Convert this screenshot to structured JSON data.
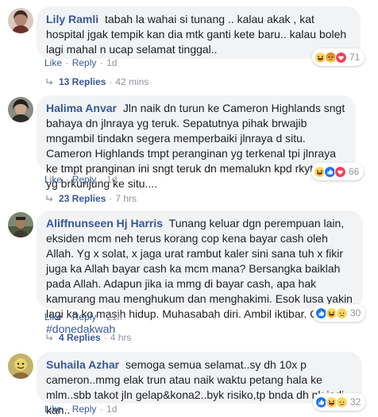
{
  "comments": [
    {
      "author": "Lily Ramli",
      "text": "tabah la wahai si tunang .. kalau akak , kat hospital jgak tempik kan dia mtk ganti kete baru.. kalau boleh lagi mahal n ucap selamat tinggal..",
      "like": "Like",
      "reply": "Reply",
      "time": "1d",
      "reaction_count": "71",
      "reaction_icons": [
        "haha-icon",
        "angry-icon",
        "love-icon"
      ],
      "replies": "13 Replies",
      "replies_time": "42 mins"
    },
    {
      "author": "Halima Anvar",
      "text": "Jln naik dn turun ke Cameron Highlands sngt bahaya dn jlnraya yg teruk. Sepatutnya pihak brwajib mngambil tindakn segera memperbaiki jlnraya d situ. Cameron Highlands tmpt peranginan yg terkenal tpi jlnraya ke tmpt pranginan ini sngt teruk dn memalukn kpd rkyt luar yg brkunjung ke situ....",
      "like": "Like",
      "reply": "Reply",
      "time": "1d",
      "reaction_count": "66",
      "reaction_icons": [
        "haha-icon",
        "like-icon",
        "love-icon"
      ],
      "replies": "23 Replies",
      "replies_time": "7 hrs"
    },
    {
      "author": "Aliffnunseen Hj Harris",
      "text": "Tunang keluar dgn perempuan lain, eksiden mcm neh terus korang cop kena bayar cash oleh Allah. Yg x solat, x jaga urat rambut kaler sini sana tuh x fikir juga ka Allah bayar cash ka mcm mana? Bersangka baiklah pada Allah. Adapun jika ia mmg di bayar cash, apa hak kamurang mau menghukum dan menghakimi. Esok lusa yakin lagi ka ko masih hidup. Muhasabah diri. Ambil iktibar. Okbaii.",
      "hashtag": "#donedakwah",
      "like": "Like",
      "reply": "Reply",
      "time": "21h",
      "reaction_count": "30",
      "reaction_icons": [
        "like-icon",
        "haha-icon",
        "sad-icon"
      ],
      "replies": "4 Replies",
      "replies_time": "4 hrs"
    },
    {
      "author": "Suhaila Azhar",
      "text": "semoga semua selamat..sy dh 10x p cameron..mmg elak trun atau naik waktu petang hala ke mlm..sbb takot jln gelap&kona2..byk risiko,tp bnda dh nk jadi kan..",
      "like": "Like",
      "reply": "Reply",
      "time": "1d",
      "reaction_count": "32",
      "reaction_icons": [
        "like-icon",
        "haha-icon",
        "sad-icon"
      ]
    }
  ],
  "colors": {
    "link": "#385898",
    "bubble": "#f2f3f5",
    "meta": "#90949c",
    "like_blue": "#1877f2",
    "love_red": "#f33e58",
    "emoji_yellow": "#fcd660",
    "angry_orange": "#e9710f"
  }
}
